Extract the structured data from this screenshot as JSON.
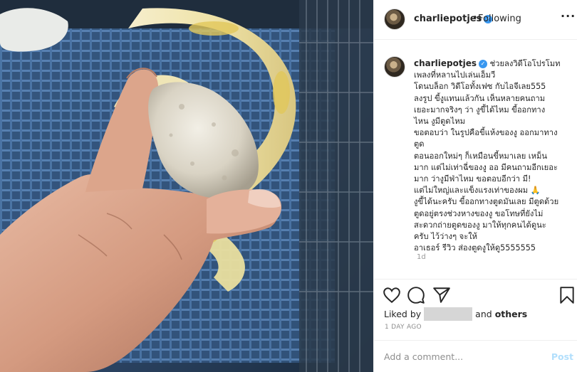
{
  "post": {
    "username": "charliepotjes",
    "verified_glyph": "✓",
    "separator": "•",
    "follow_status": "Following",
    "more_label": "···",
    "caption_user": "charliepotjes",
    "caption_text": "ช่วยลงวิดีโอโปรโมท\nเพลงที่หลานไปเล่นเอ็มวี\nโดนบล็อก วิดีโอทั้งเฟซ กับไอจีเลย555\nลงรูป ขี้งูแทนแล้วกัน เห็นหลายคนถาม\nเยอะมากจริงๆ ว่า งูขี้ได้ไหม ขี้ออกทาง\nไหน งูมีตูดไหม\nขอตอบว่า ในรูปคือขี้แห้งของงู ออกมาทาง\nตูด\nตอนออกใหม่ๆ ก็เหมือนขี้หมาเลย เหม็น\nมาก แต่ไม่เท่าฉี่ของงู ออ มีคนถามอีกเยอะ\nมาก ว่างูมีฟ่าไหม ขอตอบอีกว่า มี!\nแต่ไม่ใหญ่และแข็งแรงเท่าของผม 🙏\nงูขี้ได้นะครับ ขี้ออกทางตูดมันเลย มีตูดด้วย\nตูดอยู่ตรงช่วงหางของงู ขอโทษที่ยังไม่\nสะดวกถ่ายตูดของงู มาให้ทุกคนได้ดูนะ\nครับ ไว้ว่างๆ จะให้\nอาเธอร์ รีวิว ส่องตูดงูให้ดู5555555",
    "caption_age": "1d",
    "liked_by_prefix": "Liked by",
    "liked_by_suffix_and": "and",
    "liked_by_suffix_others": "others",
    "time_ago": "1 DAY AGO",
    "comment_placeholder": "Add a comment...",
    "post_button": "Post"
  },
  "icons": {
    "like": "heart-icon",
    "comment": "comment-bubble-icon",
    "share": "paper-plane-icon",
    "save": "bookmark-icon"
  },
  "colors": {
    "link_blue": "#3897f0",
    "post_disabled": "#b2dffc",
    "muted_text": "#8e8e8e",
    "divider": "#efefef"
  }
}
